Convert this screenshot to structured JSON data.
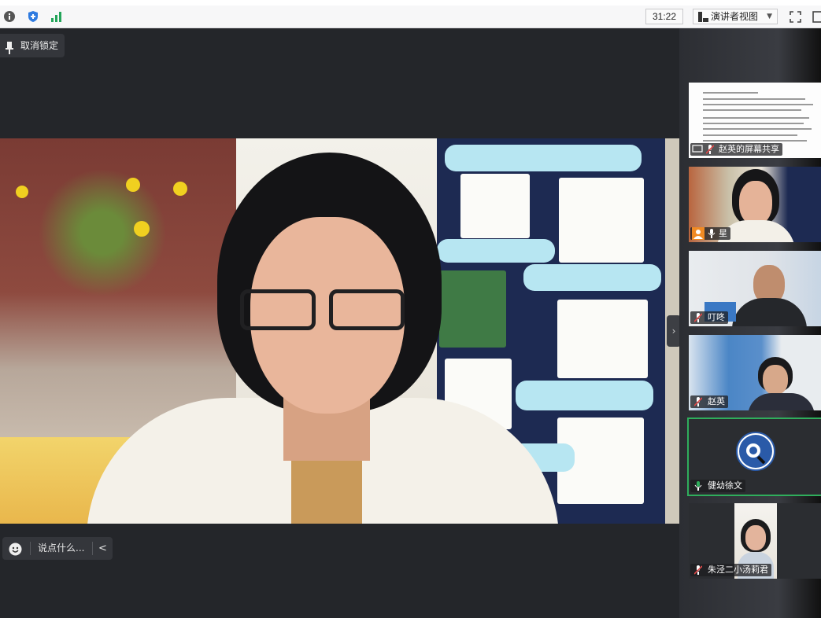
{
  "toolbar": {
    "timer": "31:22",
    "view_label": "演讲者视图",
    "info_icon": "info-icon",
    "shield_icon": "shield-icon",
    "signal_icon": "signal-icon",
    "fullscreen_icon": "fullscreen-icon"
  },
  "stage": {
    "unlock_label": "取消锁定",
    "chat_placeholder": "说点什么..."
  },
  "participants": [
    {
      "name": "赵英的屏幕共享",
      "type": "screen-share"
    },
    {
      "name": "星",
      "type": "video"
    },
    {
      "name": "叮咚",
      "type": "video"
    },
    {
      "name": "赵英",
      "type": "video"
    },
    {
      "name": "健幼徐文",
      "type": "avatar"
    },
    {
      "name": "朱泾二小汤莉君",
      "type": "video"
    }
  ],
  "colors": {
    "active_border": "#2fae5c",
    "muted_mic": "#e04848",
    "active_mic": "#ffffff"
  }
}
